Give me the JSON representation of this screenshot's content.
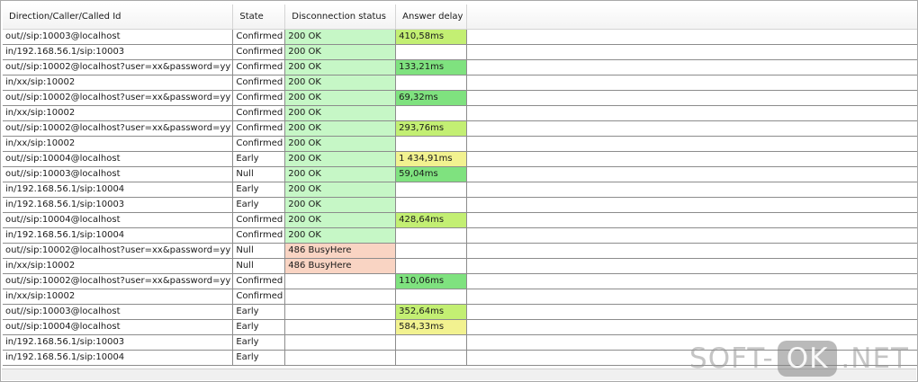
{
  "columns": [
    "Direction/Caller/Called Id",
    "State",
    "Disconnection status",
    "Answer delay"
  ],
  "rows": [
    {
      "id": "out//sip:10003@localhost",
      "state": "Confirmed",
      "status": "200 OK",
      "status_kind": "ok",
      "delay": "410,58ms",
      "delay_kind": "lime"
    },
    {
      "id": "in/192.168.56.1/sip:10003",
      "state": "Confirmed",
      "status": "200 OK",
      "status_kind": "ok",
      "delay": "",
      "delay_kind": ""
    },
    {
      "id": "out//sip:10002@localhost?user=xx&password=yy",
      "state": "Confirmed",
      "status": "200 OK",
      "status_kind": "ok",
      "delay": "133,21ms",
      "delay_kind": "green"
    },
    {
      "id": "in/xx/sip:10002",
      "state": "Confirmed",
      "status": "200 OK",
      "status_kind": "ok",
      "delay": "",
      "delay_kind": ""
    },
    {
      "id": "out//sip:10002@localhost?user=xx&password=yy",
      "state": "Confirmed",
      "status": "200 OK",
      "status_kind": "ok",
      "delay": "69,32ms",
      "delay_kind": "green"
    },
    {
      "id": "in/xx/sip:10002",
      "state": "Confirmed",
      "status": "200 OK",
      "status_kind": "ok",
      "delay": "",
      "delay_kind": ""
    },
    {
      "id": "out//sip:10002@localhost?user=xx&password=yy",
      "state": "Confirmed",
      "status": "200 OK",
      "status_kind": "ok",
      "delay": "293,76ms",
      "delay_kind": "lime"
    },
    {
      "id": "in/xx/sip:10002",
      "state": "Confirmed",
      "status": "200 OK",
      "status_kind": "ok",
      "delay": "",
      "delay_kind": ""
    },
    {
      "id": "out//sip:10004@localhost",
      "state": "Early",
      "status": "200 OK",
      "status_kind": "ok",
      "delay": "1 434,91ms",
      "delay_kind": "yellow"
    },
    {
      "id": "out//sip:10003@localhost",
      "state": "Null",
      "status": "200 OK",
      "status_kind": "ok",
      "delay": "59,04ms",
      "delay_kind": "green"
    },
    {
      "id": "in/192.168.56.1/sip:10004",
      "state": "Early",
      "status": "200 OK",
      "status_kind": "ok",
      "delay": "",
      "delay_kind": ""
    },
    {
      "id": "in/192.168.56.1/sip:10003",
      "state": "Early",
      "status": "200 OK",
      "status_kind": "ok",
      "delay": "",
      "delay_kind": ""
    },
    {
      "id": "out//sip:10004@localhost",
      "state": "Confirmed",
      "status": "200 OK",
      "status_kind": "ok",
      "delay": "428,64ms",
      "delay_kind": "lime"
    },
    {
      "id": "in/192.168.56.1/sip:10004",
      "state": "Confirmed",
      "status": "200 OK",
      "status_kind": "ok",
      "delay": "",
      "delay_kind": ""
    },
    {
      "id": "out//sip:10002@localhost?user=xx&password=yy",
      "state": "Null",
      "status": "486 BusyHere",
      "status_kind": "busy",
      "delay": "",
      "delay_kind": ""
    },
    {
      "id": "in/xx/sip:10002",
      "state": "Null",
      "status": "486 BusyHere",
      "status_kind": "busy",
      "delay": "",
      "delay_kind": ""
    },
    {
      "id": "out//sip:10002@localhost?user=xx&password=yy",
      "state": "Confirmed",
      "status": "",
      "status_kind": "",
      "delay": "110,06ms",
      "delay_kind": "green"
    },
    {
      "id": "in/xx/sip:10002",
      "state": "Confirmed",
      "status": "",
      "status_kind": "",
      "delay": "",
      "delay_kind": ""
    },
    {
      "id": "out//sip:10003@localhost",
      "state": "Early",
      "status": "",
      "status_kind": "",
      "delay": "352,64ms",
      "delay_kind": "lime"
    },
    {
      "id": "out//sip:10004@localhost",
      "state": "Early",
      "status": "",
      "status_kind": "",
      "delay": "584,33ms",
      "delay_kind": "yellow"
    },
    {
      "id": "in/192.168.56.1/sip:10003",
      "state": "Early",
      "status": "",
      "status_kind": "",
      "delay": "",
      "delay_kind": ""
    },
    {
      "id": "in/192.168.56.1/sip:10004",
      "state": "Early",
      "status": "",
      "status_kind": "",
      "delay": "",
      "delay_kind": ""
    }
  ],
  "colors": {
    "ok": "#c6f7c6",
    "busy": "#f9d4c3",
    "green": "#7fe27f",
    "lime": "#c3ef73",
    "yellow": "#f2f290"
  },
  "watermark": {
    "left": "SOFT-",
    "box": "OK",
    "right": ".NET"
  }
}
